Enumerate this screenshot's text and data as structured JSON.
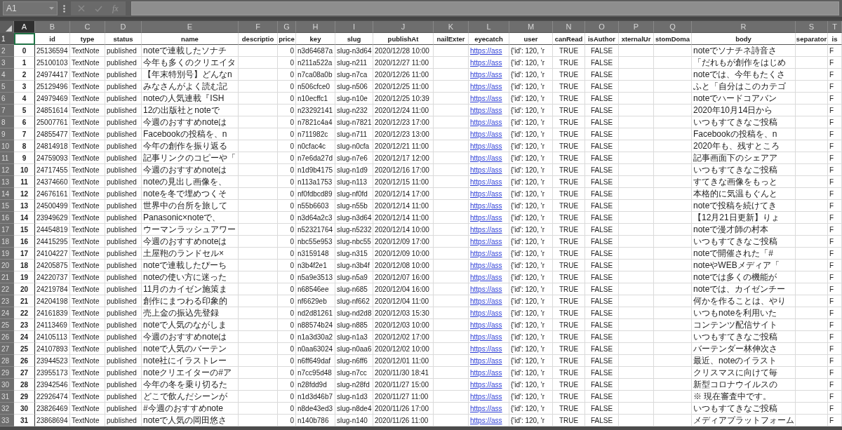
{
  "formula_bar": {
    "name_box": "A1",
    "function_label": "fx"
  },
  "columns": [
    {
      "letter": "A",
      "kind": "index",
      "selected": true
    },
    {
      "letter": "B",
      "kind": "text",
      "selected": false
    },
    {
      "letter": "C",
      "kind": "text",
      "selected": false
    },
    {
      "letter": "D",
      "kind": "text",
      "selected": false
    },
    {
      "letter": "E",
      "kind": "text",
      "selected": false
    },
    {
      "letter": "F",
      "kind": "text",
      "selected": false
    },
    {
      "letter": "G",
      "kind": "number",
      "selected": false
    },
    {
      "letter": "H",
      "kind": "text",
      "selected": false
    },
    {
      "letter": "I",
      "kind": "text",
      "selected": false
    },
    {
      "letter": "J",
      "kind": "text",
      "selected": false
    },
    {
      "letter": "K",
      "kind": "text",
      "selected": false
    },
    {
      "letter": "L",
      "kind": "link",
      "selected": false
    },
    {
      "letter": "M",
      "kind": "text",
      "selected": false
    },
    {
      "letter": "N",
      "kind": "bool",
      "selected": false
    },
    {
      "letter": "O",
      "kind": "bool",
      "selected": false
    },
    {
      "letter": "P",
      "kind": "text",
      "selected": false
    },
    {
      "letter": "Q",
      "kind": "text",
      "selected": false
    },
    {
      "letter": "R",
      "kind": "text",
      "selected": false
    },
    {
      "letter": "S",
      "kind": "text",
      "selected": false
    },
    {
      "letter": "T",
      "kind": "text",
      "selected": false
    }
  ],
  "rows": [
    {
      "number": "1",
      "kind": "header",
      "selected": true,
      "cells": {
        "B": "id",
        "C": "type",
        "D": "status",
        "E": "name",
        "F": "descriptio",
        "G": "price",
        "H": "key",
        "I": "slug",
        "J": "publishAt",
        "K": "nailExter",
        "L": "eyecatch",
        "M": "user",
        "N": "canRead",
        "O": "isAuthor",
        "P": "xternalUr",
        "Q": "stomDoma",
        "R": "body",
        "S": "separator",
        "T": "is"
      }
    },
    {
      "number": "2",
      "kind": "data",
      "selected": false,
      "cells": {
        "A": "0",
        "B": "25136594",
        "C": "TextNote",
        "D": "published",
        "E": "noteで連載したソナチ",
        "G": "0",
        "H": "n3d64687a",
        "I": "slug-n3d64",
        "J": "2020/12/28 10:00",
        "L": "https://ass",
        "M": "{'id': 120, 'r",
        "N": "TRUE",
        "O": "FALSE",
        "R": "noteでソナチネ詩音さ",
        "T": "F"
      }
    },
    {
      "number": "3",
      "kind": "data",
      "selected": false,
      "cells": {
        "A": "1",
        "B": "25100103",
        "C": "TextNote",
        "D": "published",
        "E": "今年も多くのクリエイタ",
        "G": "0",
        "H": "n211a522a",
        "I": "slug-n211",
        "J": "2020/12/27 11:00",
        "L": "https://ass",
        "M": "{'id': 120, 'r",
        "N": "TRUE",
        "O": "FALSE",
        "R": "「だれもが創作をはじめ",
        "T": "F"
      }
    },
    {
      "number": "4",
      "kind": "data",
      "selected": false,
      "cells": {
        "A": "2",
        "B": "24974417",
        "C": "TextNote",
        "D": "published",
        "E": "【年末特別号】どんなn",
        "G": "0",
        "H": "n7ca08a0b",
        "I": "slug-n7ca",
        "J": "2020/12/26 11:00",
        "L": "https://ass",
        "M": "{'id': 120, 'r",
        "N": "TRUE",
        "O": "FALSE",
        "R": "noteでは、今年もたくさ",
        "T": "F"
      }
    },
    {
      "number": "5",
      "kind": "data",
      "selected": false,
      "cells": {
        "A": "3",
        "B": "25129496",
        "C": "TextNote",
        "D": "published",
        "E": "みなさんがよく読む記",
        "G": "0",
        "H": "n506cfce0",
        "I": "slug-n506",
        "J": "2020/12/25 11:00",
        "L": "https://ass",
        "M": "{'id': 120, 'r",
        "N": "TRUE",
        "O": "FALSE",
        "R": "ふと「自分はこのカテゴ",
        "T": "F"
      }
    },
    {
      "number": "6",
      "kind": "data",
      "selected": false,
      "cells": {
        "A": "4",
        "B": "24979469",
        "C": "TextNote",
        "D": "published",
        "E": "noteの人気連載『ISH",
        "G": "0",
        "H": "n10ecffc1",
        "I": "slug-n10e",
        "J": "2020/12/25 10:39",
        "L": "https://ass",
        "M": "{'id': 120, 'r",
        "N": "TRUE",
        "O": "FALSE",
        "R": "noteでハードコアバン",
        "T": "F"
      }
    },
    {
      "number": "7",
      "kind": "data",
      "selected": false,
      "cells": {
        "A": "5",
        "B": "24851614",
        "C": "TextNote",
        "D": "published",
        "E": "12の出版社とnoteで",
        "G": "0",
        "H": "n23292141",
        "I": "slug-n232",
        "J": "2020/12/24 11:00",
        "L": "https://ass",
        "M": "{'id': 120, 'r",
        "N": "TRUE",
        "O": "FALSE",
        "R": "2020年10月14日から",
        "T": "F"
      }
    },
    {
      "number": "8",
      "kind": "data",
      "selected": false,
      "cells": {
        "A": "6",
        "B": "25007761",
        "C": "TextNote",
        "D": "published",
        "E": "今週のおすすめnoteは",
        "G": "0",
        "H": "n7821c4a4",
        "I": "slug-n7821",
        "J": "2020/12/23 17:00",
        "L": "https://ass",
        "M": "{'id': 120, 'r",
        "N": "TRUE",
        "O": "FALSE",
        "R": "いつもすてきなご投稿",
        "T": "F"
      }
    },
    {
      "number": "9",
      "kind": "data",
      "selected": false,
      "cells": {
        "A": "7",
        "B": "24855477",
        "C": "TextNote",
        "D": "published",
        "E": "Facebookの投稿を、n",
        "G": "0",
        "H": "n711982c",
        "I": "slug-n711",
        "J": "2020/12/23 13:00",
        "L": "https://ass",
        "M": "{'id': 120, 'r",
        "N": "TRUE",
        "O": "FALSE",
        "R": "Facebookの投稿を、n",
        "T": "F"
      }
    },
    {
      "number": "10",
      "kind": "data",
      "selected": false,
      "cells": {
        "A": "8",
        "B": "24814918",
        "C": "TextNote",
        "D": "published",
        "E": "今年の創作を振り返る",
        "G": "0",
        "H": "n0cfac4c",
        "I": "slug-n0cfa",
        "J": "2020/12/21 11:00",
        "L": "https://ass",
        "M": "{'id': 120, 'r",
        "N": "TRUE",
        "O": "FALSE",
        "R": "2020年も、残すところ",
        "T": "F"
      }
    },
    {
      "number": "11",
      "kind": "data",
      "selected": false,
      "cells": {
        "A": "9",
        "B": "24759093",
        "C": "TextNote",
        "D": "published",
        "E": "記事リンクのコピーや「",
        "G": "0",
        "H": "n7e6da27d",
        "I": "slug-n7e6",
        "J": "2020/12/17 12:00",
        "L": "https://ass",
        "M": "{'id': 120, 'r",
        "N": "TRUE",
        "O": "FALSE",
        "R": "記事画面下のシェアア",
        "T": "F"
      }
    },
    {
      "number": "12",
      "kind": "data",
      "selected": false,
      "cells": {
        "A": "10",
        "B": "24717455",
        "C": "TextNote",
        "D": "published",
        "E": "今週のおすすめnoteは",
        "G": "0",
        "H": "n1d9b4175",
        "I": "slug-n1d9",
        "J": "2020/12/16 17:00",
        "L": "https://ass",
        "M": "{'id': 120, 'r",
        "N": "TRUE",
        "O": "FALSE",
        "R": "いつもすてきなご投稿",
        "T": "F"
      }
    },
    {
      "number": "13",
      "kind": "data",
      "selected": false,
      "cells": {
        "A": "11",
        "B": "24374660",
        "C": "TextNote",
        "D": "published",
        "E": "noteの見出し画像を、",
        "G": "0",
        "H": "n113a1753",
        "I": "slug-n113",
        "J": "2020/12/15 11:00",
        "L": "https://ass",
        "M": "{'id': 120, 'r",
        "N": "TRUE",
        "O": "FALSE",
        "R": "すてきな画像をもっと",
        "T": "F"
      }
    },
    {
      "number": "14",
      "kind": "data",
      "selected": false,
      "cells": {
        "A": "12",
        "B": "24676161",
        "C": "TextNote",
        "D": "published",
        "E": "noteを冬で埋めつくそ",
        "G": "0",
        "H": "nf0fdbcd89",
        "I": "slug-nf0fd",
        "J": "2020/12/14 17:00",
        "L": "https://ass",
        "M": "{'id': 120, 'r",
        "N": "TRUE",
        "O": "FALSE",
        "R": "本格的に気温もぐんと",
        "T": "F"
      }
    },
    {
      "number": "15",
      "kind": "data",
      "selected": false,
      "cells": {
        "A": "13",
        "B": "24500499",
        "C": "TextNote",
        "D": "published",
        "E": "世界中の台所を旅して",
        "G": "0",
        "H": "n55b6603",
        "I": "slug-n55b",
        "J": "2020/12/14 11:00",
        "L": "https://ass",
        "M": "{'id': 120, 'r",
        "N": "TRUE",
        "O": "FALSE",
        "R": "noteで投稿を続けてき",
        "T": "F"
      }
    },
    {
      "number": "16",
      "kind": "data",
      "selected": false,
      "cells": {
        "A": "14",
        "B": "23949629",
        "C": "TextNote",
        "D": "published",
        "E": "Panasonic×noteで、",
        "G": "0",
        "H": "n3d64a2c3",
        "I": "slug-n3d64",
        "J": "2020/12/14 11:00",
        "L": "https://ass",
        "M": "{'id': 120, 'r",
        "N": "TRUE",
        "O": "FALSE",
        "R": "【12月21日更新】りょ",
        "T": "F"
      }
    },
    {
      "number": "17",
      "kind": "data",
      "selected": false,
      "cells": {
        "A": "15",
        "B": "24454819",
        "C": "TextNote",
        "D": "published",
        "E": "ウーマンラッシュアワー",
        "G": "0",
        "H": "n52321764",
        "I": "slug-n5232",
        "J": "2020/12/14 10:00",
        "L": "https://ass",
        "M": "{'id': 120, 'r",
        "N": "TRUE",
        "O": "FALSE",
        "R": "noteで漫才師の村本",
        "T": "F"
      }
    },
    {
      "number": "18",
      "kind": "data",
      "selected": false,
      "cells": {
        "A": "16",
        "B": "24415295",
        "C": "TextNote",
        "D": "published",
        "E": "今週のおすすめnoteは",
        "G": "0",
        "H": "nbc55e953",
        "I": "slug-nbc55",
        "J": "2020/12/09 17:00",
        "L": "https://ass",
        "M": "{'id': 120, 'r",
        "N": "TRUE",
        "O": "FALSE",
        "R": "いつもすてきなご投稿",
        "T": "F"
      }
    },
    {
      "number": "19",
      "kind": "data",
      "selected": false,
      "cells": {
        "A": "17",
        "B": "24104227",
        "C": "TextNote",
        "D": "published",
        "E": "土屋鞄のランドセル×",
        "G": "0",
        "H": "n3159148",
        "I": "slug-n315",
        "J": "2020/12/09 10:00",
        "L": "https://ass",
        "M": "{'id': 120, 'r",
        "N": "TRUE",
        "O": "FALSE",
        "R": "noteで開催された「#",
        "T": "F"
      }
    },
    {
      "number": "20",
      "kind": "data",
      "selected": false,
      "cells": {
        "A": "18",
        "B": "24205875",
        "C": "TextNote",
        "D": "published",
        "E": "noteで連載したぴーち",
        "G": "0",
        "H": "n3b4f2e1",
        "I": "slug-n3b4f",
        "J": "2020/12/08 10:00",
        "L": "https://ass",
        "M": "{'id': 120, 'r",
        "N": "TRUE",
        "O": "FALSE",
        "R": "noteやWEBメディア「",
        "T": "F"
      }
    },
    {
      "number": "21",
      "kind": "data",
      "selected": false,
      "cells": {
        "A": "19",
        "B": "24220737",
        "C": "TextNote",
        "D": "published",
        "E": "noteの使い方に迷った",
        "G": "0",
        "H": "n5a9e3513",
        "I": "slug-n5a9",
        "J": "2020/12/07 16:00",
        "L": "https://ass",
        "M": "{'id': 120, 'r",
        "N": "TRUE",
        "O": "FALSE",
        "R": "noteでは多くの機能が",
        "T": "F"
      }
    },
    {
      "number": "22",
      "kind": "data",
      "selected": false,
      "cells": {
        "A": "20",
        "B": "24219784",
        "C": "TextNote",
        "D": "published",
        "E": "11月のカイゼン施策ま",
        "G": "0",
        "H": "n68546ee",
        "I": "slug-n685",
        "J": "2020/12/04 16:00",
        "L": "https://ass",
        "M": "{'id': 120, 'r",
        "N": "TRUE",
        "O": "FALSE",
        "R": "noteでは、カイゼンチー",
        "T": "F"
      }
    },
    {
      "number": "23",
      "kind": "data",
      "selected": false,
      "cells": {
        "A": "21",
        "B": "24204198",
        "C": "TextNote",
        "D": "published",
        "E": "創作にまつわる印象的",
        "G": "0",
        "H": "nf6629eb",
        "I": "slug-nf662",
        "J": "2020/12/04 11:00",
        "L": "https://ass",
        "M": "{'id': 120, 'r",
        "N": "TRUE",
        "O": "FALSE",
        "R": "何かを作ることは、やり",
        "T": "F"
      }
    },
    {
      "number": "24",
      "kind": "data",
      "selected": false,
      "cells": {
        "A": "22",
        "B": "24161839",
        "C": "TextNote",
        "D": "published",
        "E": "売上金の振込先登録",
        "G": "0",
        "H": "nd2d81261",
        "I": "slug-nd2d8",
        "J": "2020/12/03 15:30",
        "L": "https://ass",
        "M": "{'id': 120, 'r",
        "N": "TRUE",
        "O": "FALSE",
        "R": "いつもnoteを利用いた",
        "T": "F"
      }
    },
    {
      "number": "25",
      "kind": "data",
      "selected": false,
      "cells": {
        "A": "23",
        "B": "24113469",
        "C": "TextNote",
        "D": "published",
        "E": "noteで人気のながしま",
        "G": "0",
        "H": "n88574b24",
        "I": "slug-n885",
        "J": "2020/12/03 10:00",
        "L": "https://ass",
        "M": "{'id': 120, 'r",
        "N": "TRUE",
        "O": "FALSE",
        "R": "コンテンツ配信サイト",
        "T": "F"
      }
    },
    {
      "number": "26",
      "kind": "data",
      "selected": false,
      "cells": {
        "A": "24",
        "B": "24105113",
        "C": "TextNote",
        "D": "published",
        "E": "今週のおすすめnoteは",
        "G": "0",
        "H": "n1a3d30a2",
        "I": "slug-n1a3",
        "J": "2020/12/02 17:00",
        "L": "https://ass",
        "M": "{'id': 120, 'r",
        "N": "TRUE",
        "O": "FALSE",
        "R": "いつもすてきなご投稿",
        "T": "F"
      }
    },
    {
      "number": "27",
      "kind": "data",
      "selected": false,
      "cells": {
        "A": "25",
        "B": "24107893",
        "C": "TextNote",
        "D": "published",
        "E": "noteで人気のバーテン",
        "G": "0",
        "H": "n0aa63024",
        "I": "slug-n0aa6",
        "J": "2020/12/02 10:00",
        "L": "https://ass",
        "M": "{'id': 120, 'r",
        "N": "TRUE",
        "O": "FALSE",
        "R": "バーテンダー林伸次さ",
        "T": "F"
      }
    },
    {
      "number": "28",
      "kind": "data",
      "selected": false,
      "cells": {
        "A": "26",
        "B": "23944523",
        "C": "TextNote",
        "D": "published",
        "E": "note社にイラストレー",
        "G": "0",
        "H": "n6ff649daf",
        "I": "slug-n6ff6",
        "J": "2020/12/01 11:00",
        "L": "https://ass",
        "M": "{'id': 120, 'r",
        "N": "TRUE",
        "O": "FALSE",
        "R": "最近、noteのイラスト",
        "T": "F"
      }
    },
    {
      "number": "29",
      "kind": "data",
      "selected": false,
      "cells": {
        "A": "27",
        "B": "23955173",
        "C": "TextNote",
        "D": "published",
        "E": "noteクリエイターの#ア",
        "G": "0",
        "H": "n7cc95d48",
        "I": "slug-n7cc",
        "J": "2020/11/30 18:41",
        "L": "https://ass",
        "M": "{'id': 120, 'r",
        "N": "TRUE",
        "O": "FALSE",
        "R": "クリスマスに向けて毎",
        "T": "F"
      }
    },
    {
      "number": "30",
      "kind": "data",
      "selected": false,
      "cells": {
        "A": "28",
        "B": "23942546",
        "C": "TextNote",
        "D": "published",
        "E": "今年の冬を乗り切るた",
        "G": "0",
        "H": "n28fdd9d",
        "I": "slug-n28fd",
        "J": "2020/11/27 15:00",
        "L": "https://ass",
        "M": "{'id': 120, 'r",
        "N": "TRUE",
        "O": "FALSE",
        "R": "新型コロナウイルスの",
        "T": "F"
      }
    },
    {
      "number": "31",
      "kind": "data",
      "selected": false,
      "cells": {
        "A": "29",
        "B": "22926474",
        "C": "TextNote",
        "D": "published",
        "E": "どこで飲んだシーンが",
        "G": "0",
        "H": "n1d3d46b7",
        "I": "slug-n1d3",
        "J": "2020/11/27 11:00",
        "L": "https://ass",
        "M": "{'id': 120, 'r",
        "N": "TRUE",
        "O": "FALSE",
        "R": "※ 現在審査中です。",
        "T": "F"
      }
    },
    {
      "number": "32",
      "kind": "data",
      "selected": false,
      "cells": {
        "A": "30",
        "B": "23826469",
        "C": "TextNote",
        "D": "published",
        "E": "#今週のおすすめnote",
        "G": "0",
        "H": "n8de43ed3",
        "I": "slug-n8de4",
        "J": "2020/11/26 17:00",
        "L": "https://ass",
        "M": "{'id': 120, 'r",
        "N": "TRUE",
        "O": "FALSE",
        "R": "いつもすてきなご投稿",
        "T": "F"
      }
    },
    {
      "number": "33",
      "kind": "data",
      "selected": false,
      "cells": {
        "A": "31",
        "B": "23868694",
        "C": "TextNote",
        "D": "published",
        "E": "noteで人気の岡田悠さ",
        "G": "0",
        "H": "n140b786",
        "I": "slug-n140",
        "J": "2020/11/26 11:00",
        "L": "https://ass",
        "M": "{'id': 120, 'r",
        "N": "TRUE",
        "O": "FALSE",
        "R": "メディアプラットフォーム",
        "T": "F"
      }
    }
  ]
}
